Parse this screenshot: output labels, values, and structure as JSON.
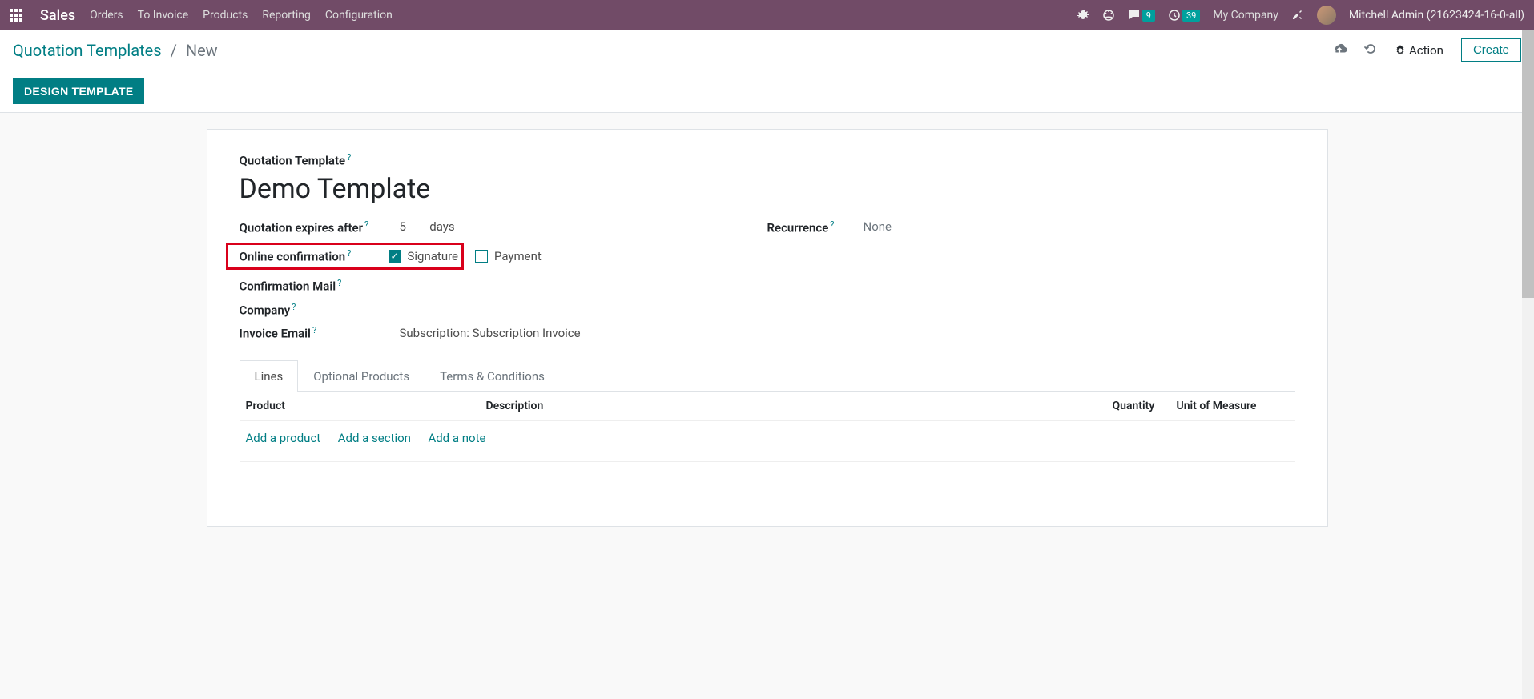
{
  "navbar": {
    "brand": "Sales",
    "menu": [
      "Orders",
      "To Invoice",
      "Products",
      "Reporting",
      "Configuration"
    ],
    "messages_badge": "9",
    "activities_badge": "39",
    "company": "My Company",
    "user": "Mitchell Admin (21623424-16-0-all)"
  },
  "breadcrumb": {
    "root": "Quotation Templates",
    "current": "New"
  },
  "cp": {
    "action": "Action",
    "create": "Create"
  },
  "statusbar": {
    "design": "DESIGN TEMPLATE"
  },
  "form": {
    "title_label": "Quotation Template",
    "title_value": "Demo Template",
    "expires_label": "Quotation expires after",
    "expires_value": "5",
    "expires_unit": "days",
    "recurrence_label": "Recurrence",
    "recurrence_value": "None",
    "online_conf_label": "Online confirmation",
    "signature_label": "Signature",
    "payment_label": "Payment",
    "conf_mail_label": "Confirmation Mail",
    "company_label": "Company",
    "invoice_email_label": "Invoice Email",
    "invoice_email_value": "Subscription: Subscription Invoice"
  },
  "tabs": [
    "Lines",
    "Optional Products",
    "Terms & Conditions"
  ],
  "table": {
    "headers": {
      "product": "Product",
      "description": "Description",
      "quantity": "Quantity",
      "uom": "Unit of Measure"
    },
    "actions": {
      "add_product": "Add a product",
      "add_section": "Add a section",
      "add_note": "Add a note"
    }
  }
}
